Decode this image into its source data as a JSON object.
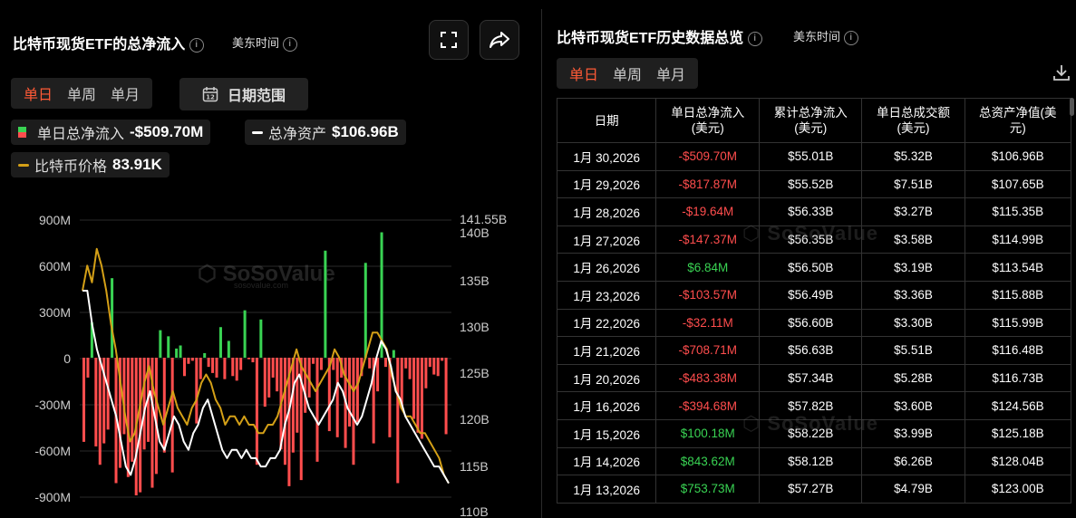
{
  "left_panel": {
    "title": "比特币现货ETF的总净流入",
    "timezone": "美东时间",
    "period_tabs": [
      "单日",
      "单周",
      "单月"
    ],
    "date_range_label": "日期范围",
    "legend": {
      "daily_inflow_label": "单日总净流入",
      "daily_inflow_value": "-$509.70M",
      "net_assets_label": "总净资产",
      "net_assets_value": "$106.96B",
      "btc_price_label": "比特币价格",
      "btc_price_value": "83.91K"
    }
  },
  "right_panel": {
    "title": "比特币现货ETF历史数据总览",
    "timezone": "美东时间",
    "period_tabs": [
      "单日",
      "单周",
      "单月"
    ],
    "table": {
      "headers": [
        "日期",
        "单日总净流入\n(美元)",
        "累计总净流入\n(美元)",
        "单日总成交额\n(美元)",
        "总资产净值(美\n元)"
      ],
      "rows": [
        {
          "date": "1月 30,2026",
          "daily": "-$509.70M",
          "cum": "$55.01B",
          "vol": "$5.32B",
          "nav": "$106.96B",
          "sign": "neg"
        },
        {
          "date": "1月 29,2026",
          "daily": "-$817.87M",
          "cum": "$55.52B",
          "vol": "$7.51B",
          "nav": "$107.65B",
          "sign": "neg"
        },
        {
          "date": "1月 28,2026",
          "daily": "-$19.64M",
          "cum": "$56.33B",
          "vol": "$3.27B",
          "nav": "$115.35B",
          "sign": "neg"
        },
        {
          "date": "1月 27,2026",
          "daily": "-$147.37M",
          "cum": "$56.35B",
          "vol": "$3.58B",
          "nav": "$114.99B",
          "sign": "neg"
        },
        {
          "date": "1月 26,2026",
          "daily": "$6.84M",
          "cum": "$56.50B",
          "vol": "$3.19B",
          "nav": "$113.54B",
          "sign": "pos"
        },
        {
          "date": "1月 23,2026",
          "daily": "-$103.57M",
          "cum": "$56.49B",
          "vol": "$3.36B",
          "nav": "$115.88B",
          "sign": "neg"
        },
        {
          "date": "1月 22,2026",
          "daily": "-$32.11M",
          "cum": "$56.60B",
          "vol": "$3.30B",
          "nav": "$115.99B",
          "sign": "neg"
        },
        {
          "date": "1月 21,2026",
          "daily": "-$708.71M",
          "cum": "$56.63B",
          "vol": "$5.51B",
          "nav": "$116.48B",
          "sign": "neg"
        },
        {
          "date": "1月 20,2026",
          "daily": "-$483.38M",
          "cum": "$57.34B",
          "vol": "$5.28B",
          "nav": "$116.73B",
          "sign": "neg"
        },
        {
          "date": "1月 16,2026",
          "daily": "-$394.68M",
          "cum": "$57.82B",
          "vol": "$3.60B",
          "nav": "$124.56B",
          "sign": "neg"
        },
        {
          "date": "1月 15,2026",
          "daily": "$100.18M",
          "cum": "$58.22B",
          "vol": "$3.99B",
          "nav": "$125.18B",
          "sign": "pos"
        },
        {
          "date": "1月 14,2026",
          "daily": "$843.62M",
          "cum": "$58.12B",
          "vol": "$6.26B",
          "nav": "$128.04B",
          "sign": "pos"
        },
        {
          "date": "1月 13,2026",
          "daily": "$753.73M",
          "cum": "$57.27B",
          "vol": "$4.79B",
          "nav": "$123.00B",
          "sign": "pos"
        }
      ]
    }
  },
  "watermark": {
    "text": "SoSoValue",
    "sub": "sosovalue.com"
  },
  "colors": {
    "accent": "#ff5a36",
    "negative": "#ff4d4d",
    "positive": "#39d353",
    "btc_line": "#d4a017",
    "nav_line": "#ffffff"
  },
  "chart_data": {
    "type": "bar",
    "left_axis": {
      "ticks": [
        "900M",
        "600M",
        "300M",
        "0",
        "-300M",
        "-600M",
        "-900M"
      ],
      "ylim": [
        -900,
        900
      ],
      "unit": "M"
    },
    "right_axis": {
      "ticks": [
        "141.55B",
        "140B",
        "135B",
        "130B",
        "125B",
        "120B",
        "115B",
        "110B"
      ],
      "ylim": [
        110,
        141.55
      ],
      "unit": "B"
    },
    "series": [
      {
        "name": "单日总净流入",
        "type": "bar",
        "values": [
          -550,
          -130,
          230,
          -580,
          -700,
          -560,
          -470,
          520,
          -820,
          -720,
          -500,
          -780,
          -680,
          -900,
          -880,
          -600,
          -550,
          -850,
          -760,
          180,
          -620,
          140,
          -750,
          60,
          80,
          -120,
          -40,
          -20,
          -430,
          -140,
          30,
          -60,
          -100,
          -130,
          200,
          -140,
          110,
          -120,
          -150,
          -80,
          310,
          -10,
          -30,
          -700,
          250,
          -320,
          -260,
          -130,
          -220,
          -600,
          -700,
          -840,
          -620,
          -490,
          -800,
          -360,
          -260,
          -40,
          -680,
          -80,
          700,
          -480,
          -80,
          -520,
          -130,
          -590,
          -450,
          -700,
          -420,
          -120,
          620,
          -70,
          -560,
          -220,
          820,
          -60,
          -520,
          50,
          -820,
          -320,
          -70,
          -140,
          -400,
          -490,
          -530,
          -200,
          -60,
          -110,
          -120,
          -20,
          -500
        ],
        "tail_labelled": [
          -509.7
        ]
      },
      {
        "name": "总净资产",
        "type": "line",
        "values": [
          133,
          133,
          129,
          126,
          124,
          122,
          120,
          118,
          115,
          112,
          111,
          113,
          116,
          119,
          121,
          118,
          115,
          114,
          116,
          118,
          117,
          115,
          114,
          116,
          117,
          119,
          120,
          118,
          116,
          114,
          113,
          114,
          114,
          113,
          114,
          113,
          113,
          112,
          112,
          113,
          113,
          114,
          117,
          119,
          122,
          123,
          121,
          119,
          118,
          117,
          118,
          119,
          120,
          122,
          121,
          119,
          118,
          117,
          118,
          120,
          122,
          125,
          127,
          126,
          124,
          121,
          120,
          118,
          117,
          116,
          115,
          114,
          113,
          112,
          112,
          111,
          110
        ]
      },
      {
        "name": "比特币价格",
        "type": "line",
        "values": [
          133,
          136,
          134,
          138,
          136,
          133,
          129,
          126,
          122,
          118,
          115,
          116,
          119,
          122,
          124,
          121,
          119,
          117,
          119,
          121,
          119,
          118,
          117,
          119,
          120,
          122,
          123,
          122,
          120,
          119,
          117,
          118,
          118,
          117,
          118,
          117,
          117,
          116,
          116,
          117,
          117,
          118,
          120,
          122,
          124,
          126,
          124,
          123,
          122,
          121,
          122,
          123,
          124,
          126,
          125,
          123,
          122,
          121,
          122,
          124,
          126,
          128,
          128,
          127,
          126,
          123,
          121,
          119,
          118,
          118,
          117,
          116,
          116,
          115,
          114,
          113,
          111,
          110
        ]
      }
    ]
  }
}
